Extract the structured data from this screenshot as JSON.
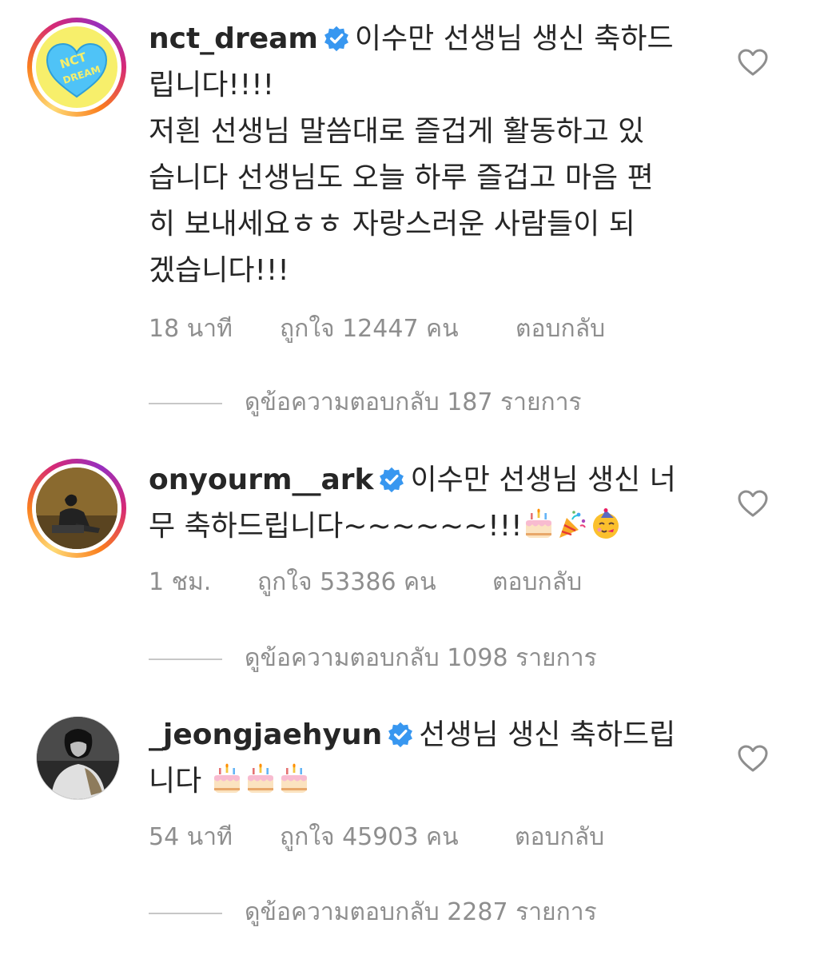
{
  "comments": [
    {
      "username": "nct_dream",
      "lines": [
        "이수만 선생님 생신 축하드",
        "립니다!!!!",
        "저흰 선생님 말씀대로 즐겁게 활동하고 있",
        "습니다 선생님도 오늘 하루 즐겁고 마음 편",
        "히 보내세요ㅎㅎ 자랑스러운 사람들이 되",
        "겠습니다!!!"
      ],
      "time": "18 นาที",
      "likes": "ถูกใจ 12447 คน",
      "reply_label": "ตอบกลับ",
      "view_replies": "ดูข้อความตอบกลับ 187 รายการ",
      "avatar_text": "NCT DREAM"
    },
    {
      "username": "onyourm__ark",
      "lines": [
        "이수만 선생님 생신 너",
        "무 축하드립니다~~~~~~!!!"
      ],
      "emojis": [
        "birthday-cake",
        "party-popper",
        "partying-face"
      ],
      "time": "1 ชม.",
      "likes": "ถูกใจ 53386 คน",
      "reply_label": "ตอบกลับ",
      "view_replies": "ดูข้อความตอบกลับ 1098 รายการ"
    },
    {
      "username": "_jeongjaehyun",
      "lines": [
        "선생님 생신 축하드립",
        "니다"
      ],
      "emojis": [
        "birthday-cake",
        "birthday-cake",
        "birthday-cake"
      ],
      "time": "54 นาที",
      "likes": "ถูกใจ 45903 คน",
      "reply_label": "ตอบกลับ",
      "view_replies": "ดูข้อความตอบกลับ 2287 รายการ"
    }
  ],
  "colors": {
    "verified": "#3897f0",
    "muted": "#8e8e8e",
    "text": "#262626"
  }
}
